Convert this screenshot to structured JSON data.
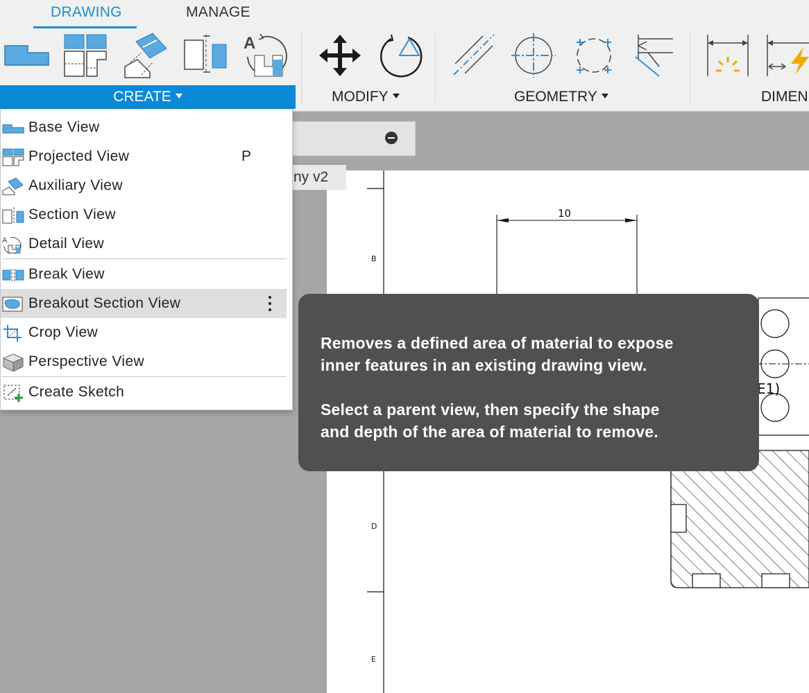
{
  "tabs": {
    "drawing": "DRAWING",
    "manage": "MANAGE"
  },
  "groups": {
    "create": "CREATE",
    "modify": "MODIFY",
    "geometry": "GEOMETRY",
    "dimensions": "DIMEN"
  },
  "canvas": {
    "document_name": "ny v2"
  },
  "menu": {
    "items": [
      {
        "label": "Base View",
        "shortcut": ""
      },
      {
        "label": "Projected View",
        "shortcut": "P"
      },
      {
        "label": "Auxiliary View",
        "shortcut": ""
      },
      {
        "label": "Section View",
        "shortcut": ""
      },
      {
        "label": "Detail View",
        "shortcut": ""
      },
      {
        "label": "Break View",
        "shortcut": ""
      },
      {
        "label": "Breakout Section View",
        "shortcut": "",
        "highlighted": true
      },
      {
        "label": "Crop View",
        "shortcut": ""
      },
      {
        "label": "Perspective View",
        "shortcut": ""
      },
      {
        "label": "Create Sketch",
        "shortcut": ""
      }
    ]
  },
  "tooltip": {
    "line1": "Removes a defined area of material to expose",
    "line2": "inner features in an existing drawing view.",
    "line3": "Select a parent view, then specify the shape",
    "line4": "and depth of the area of material to remove."
  },
  "drawing": {
    "dimension_text": "10",
    "zone_b": "B",
    "zone_d": "D",
    "zone_e": "E",
    "partial_label": "E1)"
  },
  "colors": {
    "accent": "#1b8fd2",
    "create_bar": "#0a8ad6",
    "icon_blue": "#5aa9e0",
    "tooltip_bg": "#505050",
    "highlight": "#dedede"
  }
}
